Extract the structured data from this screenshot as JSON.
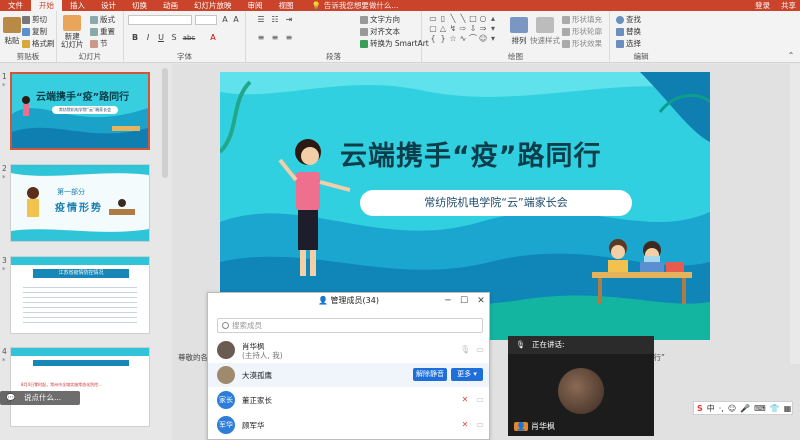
{
  "tabs": [
    "文件",
    "开始",
    "插入",
    "设计",
    "切换",
    "动画",
    "幻灯片放映",
    "审阅",
    "视图"
  ],
  "active_tab": "开始",
  "tell_me": "告诉我您想要做什么...",
  "account": {
    "login": "登录",
    "share": "共享"
  },
  "ribbon": {
    "clipboard": {
      "label": "剪贴板",
      "paste": "粘贴",
      "cut": "剪切",
      "copy": "复制",
      "format_painter": "格式刷"
    },
    "slides": {
      "label": "幻灯片",
      "new_slide": "新建\n幻灯片",
      "layout": "版式",
      "reset": "重置",
      "section": "节"
    },
    "font": {
      "label": "字体",
      "bold": "B",
      "italic": "I",
      "underline": "U",
      "shadow": "S",
      "strike": "abc"
    },
    "paragraph": {
      "label": "段落",
      "text_direction": "文字方向",
      "align_text": "对齐文本",
      "smartart": "转换为 SmartArt"
    },
    "drawing": {
      "label": "绘图",
      "arrange": "排列",
      "quick_styles": "快速样式",
      "shape_fill": "形状填充",
      "shape_outline": "形状轮廓",
      "shape_effects": "形状效果"
    },
    "editing": {
      "label": "编辑",
      "find": "查找",
      "replace": "替换",
      "select": "选择"
    }
  },
  "slide_numbers": [
    "1",
    "2",
    "3",
    "4"
  ],
  "thumbs": {
    "t1_title": "云端携手“疫”路同行",
    "t1_sub": "常纺院机电学院“云”端家长会",
    "t2_part": "第一部分",
    "t2_title": "疫情形势",
    "t3_header": "江苏省疫情防控情况",
    "t4_left": "8月4日零时起，常州市全域实施常态化防控..."
  },
  "slide": {
    "title": "云端携手“疫”路同行",
    "subtitle": "常纺院机电学院“云”端家长会"
  },
  "notes_text": "尊敬的各位家长…",
  "notes_tail": "同行”",
  "members": {
    "title": "管理成员",
    "count": "(34)",
    "search_placeholder": "搜索成员",
    "list": [
      {
        "name": "肖华枫",
        "sub": "(主持人, 我)"
      },
      {
        "name": "大漠孤鹰",
        "mute_all": "解除静音",
        "more": "更多 ▾"
      },
      {
        "avatar": "家长",
        "name": "董正家长"
      },
      {
        "avatar": "军华",
        "name": "顾军华"
      }
    ]
  },
  "speaker": {
    "speaking": "正在讲话:",
    "name": "肖华枫"
  },
  "chat_placeholder": "说点什么...",
  "ime": {
    "mode": "中",
    "punct": "·,"
  },
  "colors": {
    "accent": "#c9442a",
    "slide_bg": "#31d0e0",
    "primary_blue": "#1e6fd9"
  }
}
